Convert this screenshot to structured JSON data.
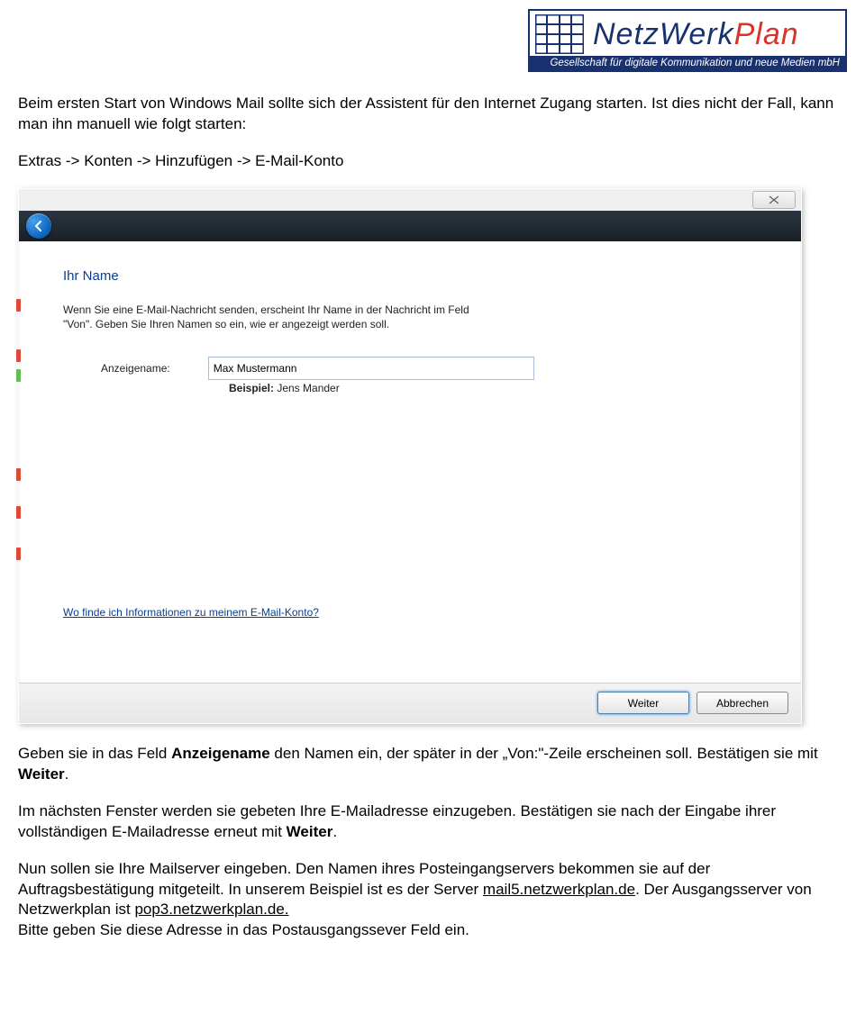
{
  "logo": {
    "text_part1": "NetzWerk",
    "text_part2": "Plan",
    "subtitle": "Gesellschaft für digitale Kommunikation und neue Medien mbH"
  },
  "intro": {
    "p1a": "Beim ersten Start von Windows Mail sollte sich der Assistent für den Internet Zugang starten. Ist dies nicht der Fall, kann man ihn manuell wie folgt starten:",
    "p1b": "Extras -> Konten -> Hinzufügen -> E-Mail-Konto"
  },
  "dialog": {
    "heading": "Ihr Name",
    "description": "Wenn Sie eine E-Mail-Nachricht senden, erscheint Ihr Name in der Nachricht im Feld \"Von\". Geben Sie Ihren Namen so ein, wie er angezeigt werden soll.",
    "label_displayname": "Anzeigename:",
    "value_displayname": "Max Mustermann",
    "example_label": "Beispiel:",
    "example_value": "Jens Mander",
    "helplink": "Wo finde ich Informationen zu meinem E-Mail-Konto?",
    "btn_next": "Weiter",
    "btn_cancel": "Abbrechen"
  },
  "after": {
    "p2_pre": "Geben sie in das Feld ",
    "p2_bold1": "Anzeigename",
    "p2_mid1": " den Namen ein, der später in der „Von:\"-Zeile erscheinen soll. Bestätigen sie mit ",
    "p2_bold2": "Weiter",
    "p2_end1": ".",
    "p3_pre": "Im nächsten Fenster werden sie gebeten Ihre E-Mailadresse einzugeben. Bestätigen sie nach der Eingabe ihrer vollständigen E-Mailadresse erneut mit ",
    "p3_bold": "Weiter",
    "p3_end": ".",
    "p4_pre": "Nun sollen sie Ihre Mailserver eingeben. Den Namen ihres Posteingangservers bekommen sie auf der Auftragsbestätigung mitgeteilt. In unserem Beispiel ist es der Server ",
    "p4_link1": "mail5.netzwerkplan.de",
    "p4_mid": ". Der Ausgangsserver von Netzwerkplan ist ",
    "p4_link2": "pop3.netzwerkplan.de.",
    "p5": "Bitte geben Sie diese Adresse in das Postausgangssever Feld ein."
  }
}
